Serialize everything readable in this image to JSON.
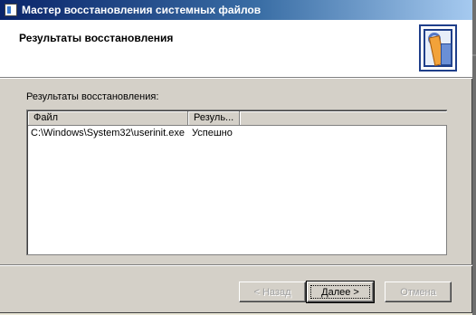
{
  "window": {
    "title": "Мастер восстановления системных файлов",
    "title_icon": "wizard-app-icon"
  },
  "header": {
    "title": "Результаты восстановления",
    "icon": "repair-tools-icon"
  },
  "results": {
    "label": "Результаты восстановления:",
    "columns": [
      "Файл",
      "Резуль..."
    ],
    "rows": [
      {
        "file": "C:\\Windows\\System32\\userinit.exe",
        "result": "Успешно"
      }
    ]
  },
  "buttons": {
    "back": "< Назад",
    "next": "Далее >",
    "cancel": "Отмена"
  }
}
